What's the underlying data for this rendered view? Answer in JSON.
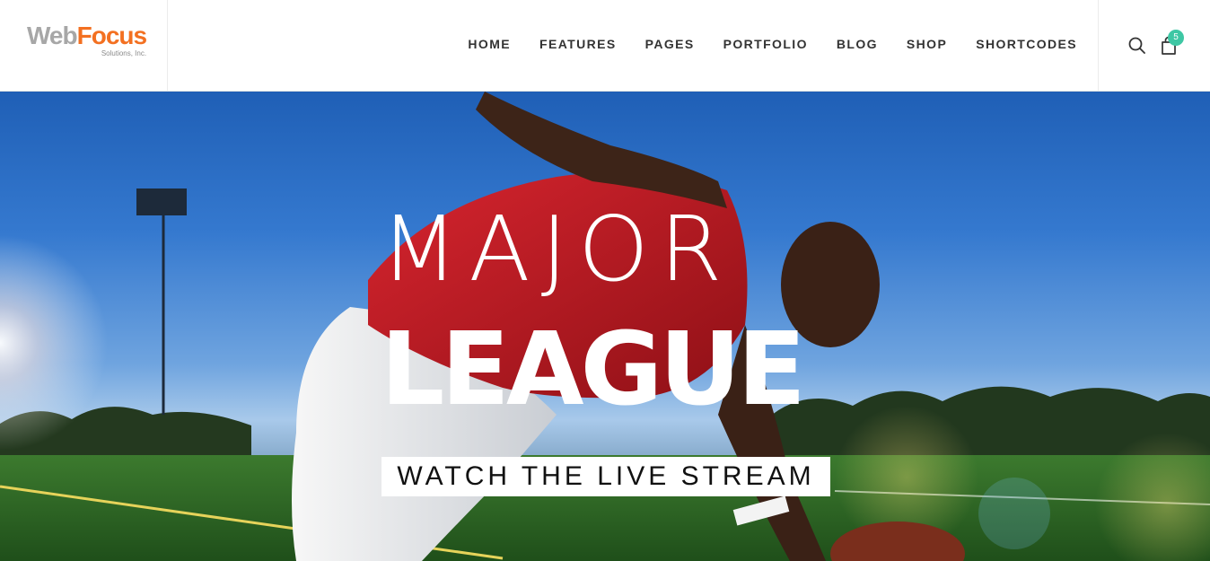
{
  "logo": {
    "part1": "Web",
    "part2": "Focus",
    "subtitle": "Solutions, Inc."
  },
  "nav": [
    "HOME",
    "FEATURES",
    "PAGES",
    "PORTFOLIO",
    "BLOG",
    "SHOP",
    "SHORTCODES"
  ],
  "cart": {
    "count": "5"
  },
  "hero": {
    "title_light": "MAJOR",
    "title_bold": "LEAGUE",
    "cta": "WATCH THE LIVE STREAM"
  },
  "colors": {
    "accent": "#3ec7a4",
    "logo_orange": "#f37021",
    "logo_gray": "#a7a7a7"
  },
  "icons": {
    "search": "search-icon",
    "cart": "shopping-bag-icon"
  }
}
